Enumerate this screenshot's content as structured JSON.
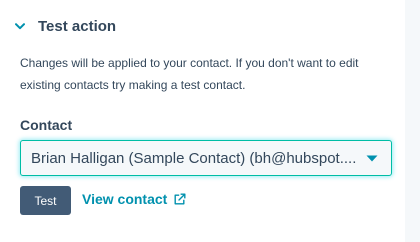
{
  "section": {
    "title": "Test action",
    "icon": "chevron-down-icon",
    "description": "Changes will be applied to your contact. If you don't want to edit existing contacts try making a test contact."
  },
  "contact_field": {
    "label": "Contact",
    "selected_value": "Brian Halligan (Sample Contact) (bh@hubspot....",
    "caret_icon": "caret-down-icon"
  },
  "actions": {
    "test_label": "Test",
    "view_contact_label": "View contact",
    "external_icon": "external-link-icon"
  },
  "colors": {
    "accent_teal": "#00bda5",
    "link": "#0091ae",
    "button_bg": "#425b76",
    "text": "#33475b"
  }
}
